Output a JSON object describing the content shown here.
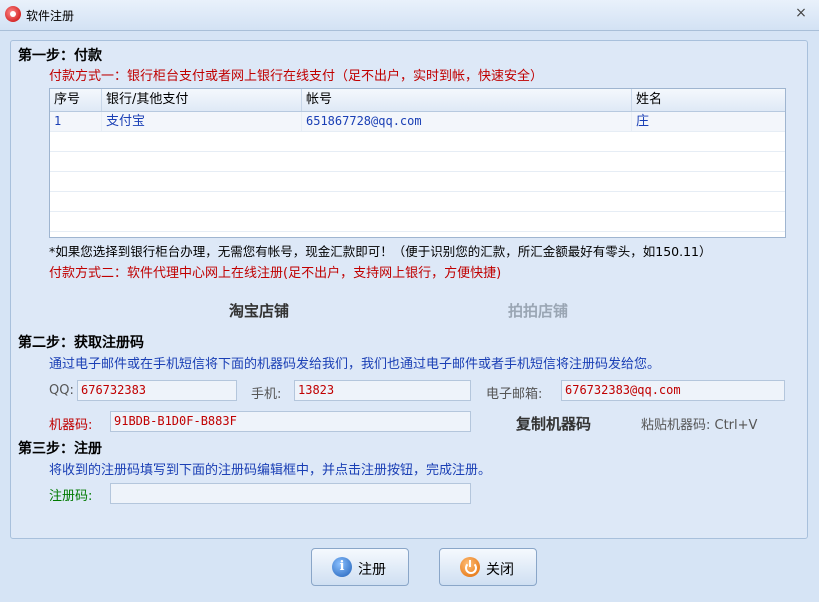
{
  "window": {
    "title": "软件注册",
    "close_glyph": "×"
  },
  "step1": {
    "title": "第一步：付款",
    "method1": "付款方式一：银行柜台支付或者网上银行在线支付（足不出户，实时到帐，快速安全）",
    "table": {
      "headers": [
        "序号",
        "银行/其他支付",
        "帐号",
        "姓名"
      ],
      "rows": [
        [
          "1",
          "支付宝",
          "651867728@qq.com",
          "庄"
        ]
      ]
    },
    "note": "*如果您选择到银行柜台办理，无需您有帐号，现金汇款即可！（便于识别您的汇款，所汇金额最好有零头，如150.11）",
    "method2": "付款方式二：软件代理中心网上在线注册(足不出户，支持网上银行，方便快捷)",
    "taobao_link": "淘宝店铺",
    "paipai_link": "拍拍店铺"
  },
  "step2": {
    "title": "第二步：获取注册码",
    "desc": "通过电子邮件或在手机短信将下面的机器码发给我们，我们也通过电子邮件或者手机短信将注册码发给您。",
    "qq_label": "QQ:",
    "qq_value": "676732383",
    "phone_label": "手机:",
    "phone_value": "13823",
    "email_label": "电子邮箱:",
    "email_value": "676732383@qq.com",
    "machine_label": "机器码:",
    "machine_value": "91BDB-B1D0F-B883F",
    "copy_button": "复制机器码",
    "paste_hint": "粘贴机器码: Ctrl+V"
  },
  "step3": {
    "title": "第三步：注册",
    "desc": "将收到的注册码填写到下面的注册码编辑框中，并点击注册按钮，完成注册。",
    "code_label": "注册码:",
    "code_value": ""
  },
  "buttons": {
    "register": "注册",
    "close": "关闭",
    "info_glyph": "i"
  },
  "icons": {
    "app": "app-logo-icon",
    "close": "close-icon",
    "info": "info-icon",
    "power": "power-icon"
  },
  "colors": {
    "accent_red": "#c00000",
    "text_blue": "#1a3fb5",
    "label_green": "#007a00",
    "panel_bg": "#dde8f7"
  }
}
